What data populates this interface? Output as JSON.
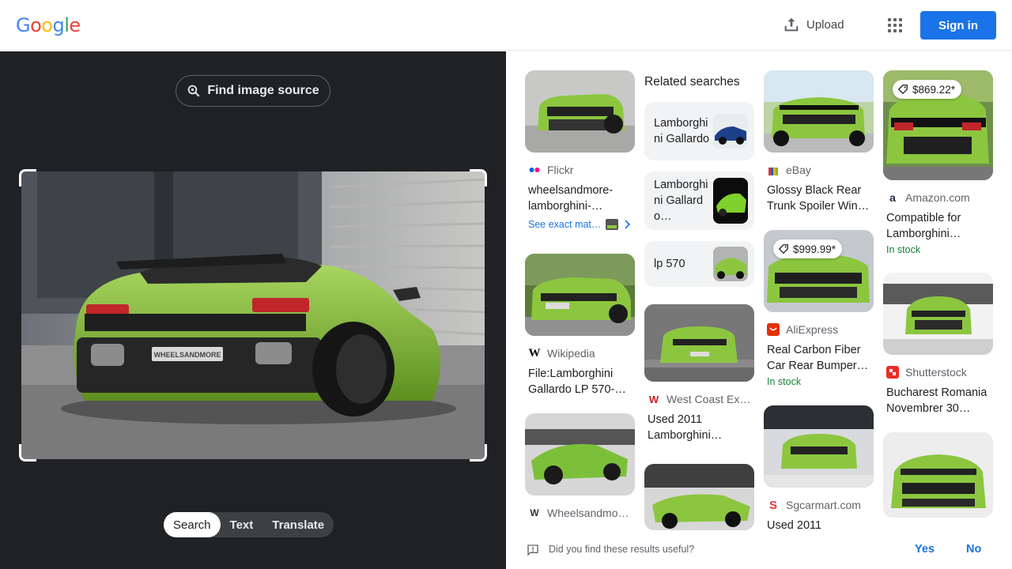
{
  "header": {
    "logo_letters": [
      "G",
      "o",
      "o",
      "g",
      "l",
      "e"
    ],
    "logo_colors": [
      "#4285f4",
      "#ea4335",
      "#fbbc05",
      "#4285f4",
      "#34a853",
      "#ea4335"
    ],
    "upload_label": "Upload",
    "signin_label": "Sign in"
  },
  "lens": {
    "find_source_label": "Find image source",
    "modes": [
      "Search",
      "Text",
      "Translate"
    ],
    "active_mode": "Search",
    "plate_text": "WHEELSANDMORE"
  },
  "results": {
    "col1": [
      {
        "source": "Flickr",
        "title": "wheelsandmore-lamborghini-…",
        "exact_label": "See exact mat…",
        "favicon_color": "#0063dc"
      },
      {
        "source": "Wikipedia",
        "title": "File:Lamborghini Gallardo LP 570-…",
        "favicon_color": "#000000"
      },
      {
        "source": "Wheelsandmo…",
        "title": ""
      }
    ],
    "related": {
      "heading": "Related searches",
      "items": [
        "Lamborghini Gallardo",
        "Lamborghini Gallardo…",
        "lp 570"
      ]
    },
    "col2": [
      {
        "source": "West Coast Ex…",
        "title": "Used 2011 Lamborghini…",
        "favicon_color": "#c5221f"
      }
    ],
    "col3": [
      {
        "source": "eBay",
        "title": "Glossy Black Rear Trunk Spoiler Win…",
        "favicon_color": "#e53238"
      },
      {
        "source": "AliExpress",
        "title": "Real Carbon Fiber Car Rear Bumper…",
        "price": "$999.99*",
        "stock": "In stock",
        "favicon_color": "#e62e04"
      },
      {
        "source": "Sgcarmart.com",
        "title": "Used 2011",
        "favicon_color": "#e53935"
      }
    ],
    "col4": [
      {
        "source": "Amazon.com",
        "title": "Compatible for Lamborghini…",
        "price": "$869.22*",
        "stock": "In stock",
        "favicon_color": "#232f3e"
      },
      {
        "source": "Shutterstock",
        "title": "Bucharest Romania Novembrer 30…",
        "favicon_color": "#ee2b24"
      }
    ]
  },
  "feedback": {
    "question": "Did you find these results useful?",
    "yes_label": "Yes",
    "no_label": "No"
  }
}
